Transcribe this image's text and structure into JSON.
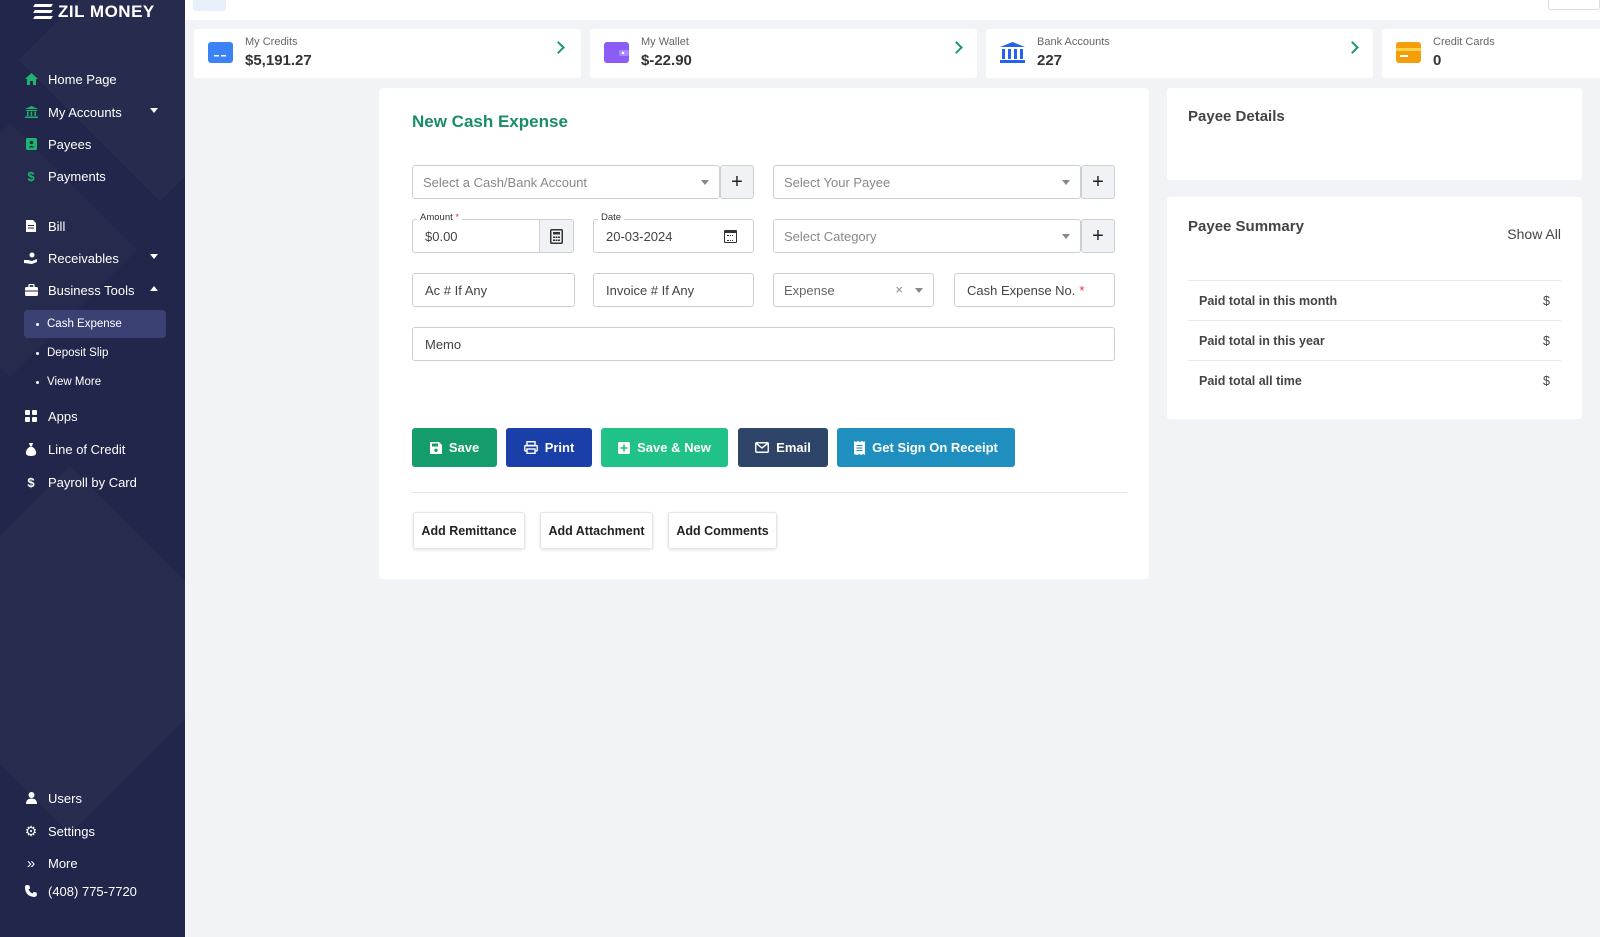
{
  "brand": {
    "name": "ZIL MONEY"
  },
  "sidebar": {
    "items": [
      {
        "label": "Home Page",
        "icon": "home-icon"
      },
      {
        "label": "My Accounts",
        "icon": "bank-icon"
      },
      {
        "label": "Payees",
        "icon": "address-book-icon"
      },
      {
        "label": "Payments",
        "icon": "dollar-icon"
      },
      {
        "label": "Bill",
        "icon": "file-icon"
      },
      {
        "label": "Receivables",
        "icon": "hand-coin-icon"
      },
      {
        "label": "Business Tools",
        "icon": "briefcase-icon"
      },
      {
        "label": "Apps",
        "icon": "grid-icon"
      },
      {
        "label": "Line of Credit",
        "icon": "money-bag-icon"
      },
      {
        "label": "Payroll by Card",
        "icon": "dollar-icon"
      }
    ],
    "sub_items": [
      {
        "label": "Cash Expense",
        "active": true
      },
      {
        "label": "Deposit Slip"
      },
      {
        "label": "View More"
      }
    ],
    "bottom": {
      "users": "Users",
      "settings": "Settings",
      "more": "More",
      "phone": "(408) 775-7720"
    }
  },
  "stats": [
    {
      "label": "My Credits",
      "value": "$5,191.27",
      "color": "#3b82f6"
    },
    {
      "label": "My Wallet",
      "value": "$-22.90",
      "color": "#8b5cf6"
    },
    {
      "label": "Bank Accounts",
      "value": "227",
      "color": "#2563eb"
    },
    {
      "label": "Credit Cards",
      "value": "0",
      "color": "#f59e0b"
    }
  ],
  "form": {
    "title": "New Cash Expense",
    "account_placeholder": "Select a Cash/Bank Account",
    "payee_placeholder": "Select Your Payee",
    "amount_label": "Amount",
    "amount_value": "$0.00",
    "date_label": "Date",
    "date_value": "20-03-2024",
    "category_placeholder": "Select Category",
    "ac_placeholder": "Ac # If Any",
    "invoice_placeholder": "Invoice # If Any",
    "type_value": "Expense",
    "cash_expense_no": "Cash Expense No.",
    "memo_placeholder": "Memo",
    "required_mark": "*"
  },
  "actions": {
    "save": "Save",
    "print": "Print",
    "save_new": "Save & New",
    "email": "Email",
    "sign_receipt": "Get Sign On Receipt",
    "colors": {
      "save": "#149c6b",
      "print": "#1b3fa8",
      "save_new": "#20c287",
      "email": "#2e4469",
      "sign_receipt": "#1f8fbf"
    }
  },
  "secondary": {
    "remittance": "Add Remittance",
    "attachment": "Add Attachment",
    "comments": "Add Comments"
  },
  "payee_details": {
    "title": "Payee Details"
  },
  "payee_summary": {
    "title": "Payee Summary",
    "show_all": "Show All",
    "rows": [
      {
        "label": "Paid total in this month",
        "value": "$"
      },
      {
        "label": "Paid total in this year",
        "value": "$"
      },
      {
        "label": "Paid total all time",
        "value": "$"
      }
    ]
  }
}
